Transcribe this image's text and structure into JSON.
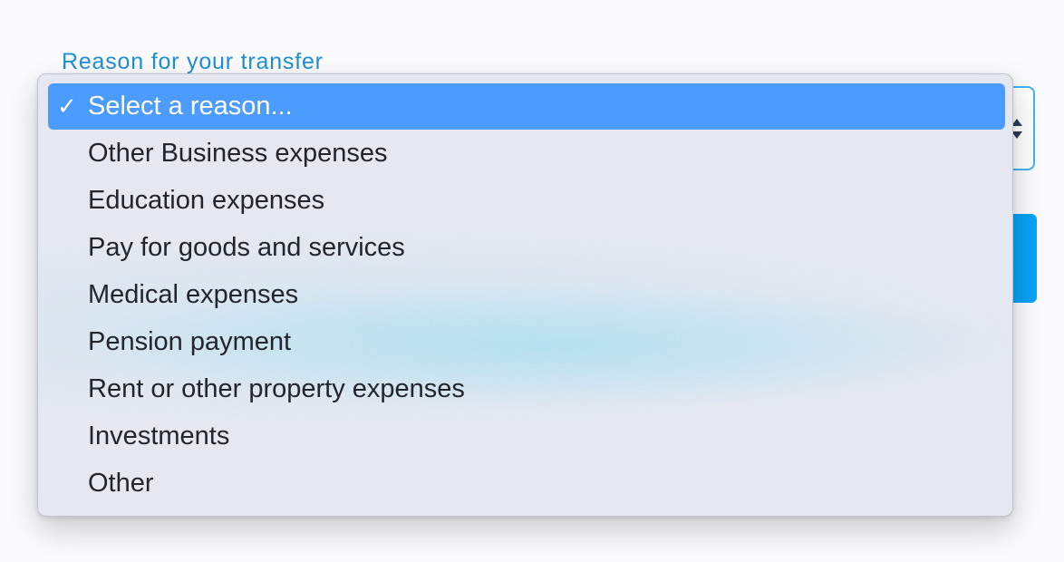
{
  "field": {
    "label": "Reason for your transfer"
  },
  "colors": {
    "label_blue": "#1f8fd6",
    "selection_blue": "#4c9bff",
    "button_blue": "#0aa2f5",
    "menu_background": "#e6e8f1",
    "item_text": "#23252b"
  },
  "icons": {
    "selected_marker": "checkmark-icon",
    "select_arrows": "up-down-arrows-icon"
  },
  "dropdown": {
    "selected_index": 0,
    "checkmark_glyph": "✓",
    "options": [
      "Select a reason...",
      "Other Business expenses",
      "Education expenses",
      "Pay for goods and services",
      "Medical expenses",
      "Pension payment",
      "Rent or other property expenses",
      "Investments",
      "Other"
    ]
  }
}
